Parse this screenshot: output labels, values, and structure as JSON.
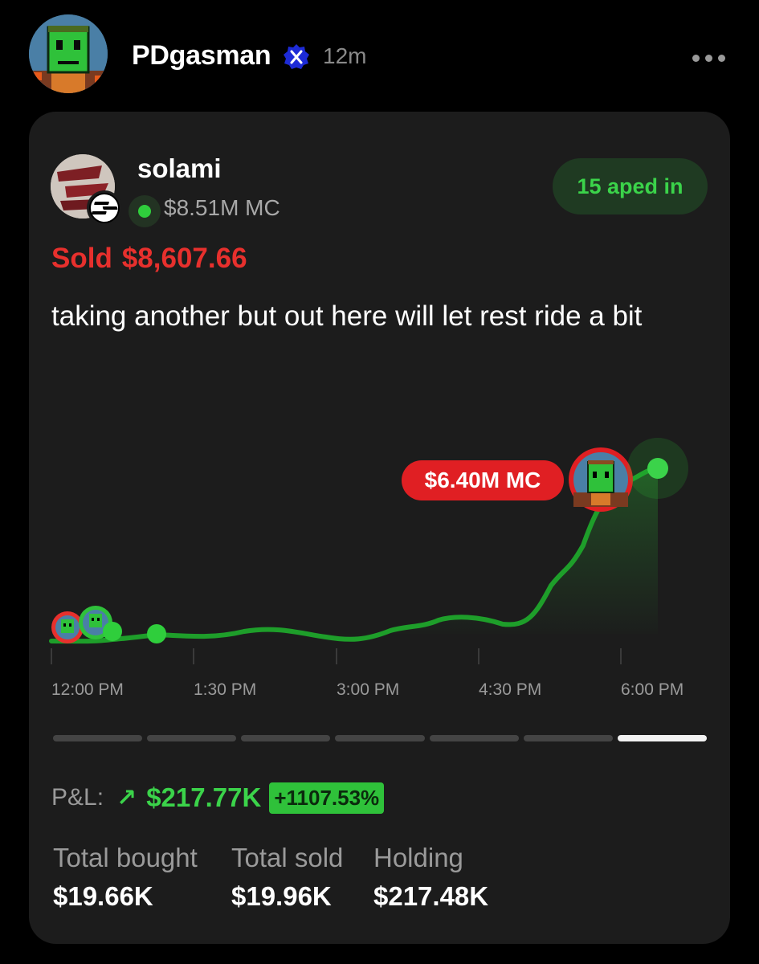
{
  "post": {
    "username": "PDgasman",
    "time": "12m",
    "verified_icon": "x-verified-badge-icon",
    "more_icon": "more-horizontal-icon"
  },
  "card": {
    "token_name": "solami",
    "market_cap": "$8.51M MC",
    "aped_in": "15 aped in",
    "sold_label": "Sold",
    "sold_amount": "$8,607.66",
    "text": "taking another but out here will let rest ride a bit"
  },
  "chart_data": {
    "type": "line",
    "x": [
      "12:00 PM",
      "1:30 PM",
      "3:00 PM",
      "4:30 PM",
      "6:00 PM"
    ],
    "annotation": "$6.40M MC",
    "timeframe_tabs_count": 7,
    "active_tab_index": 6
  },
  "pnl": {
    "label": "P&L:",
    "arrow": "↗",
    "value": "$217.77K",
    "percent": "+1107.53%"
  },
  "stats": [
    {
      "label": "Total bought",
      "value": "$19.66K"
    },
    {
      "label": "Total sold",
      "value": "$19.96K"
    },
    {
      "label": "Holding",
      "value": "$217.48K"
    }
  ],
  "colors": {
    "accent_green": "#3bd34a",
    "sell_red": "#e7302d",
    "card_bg": "#1c1c1c"
  }
}
